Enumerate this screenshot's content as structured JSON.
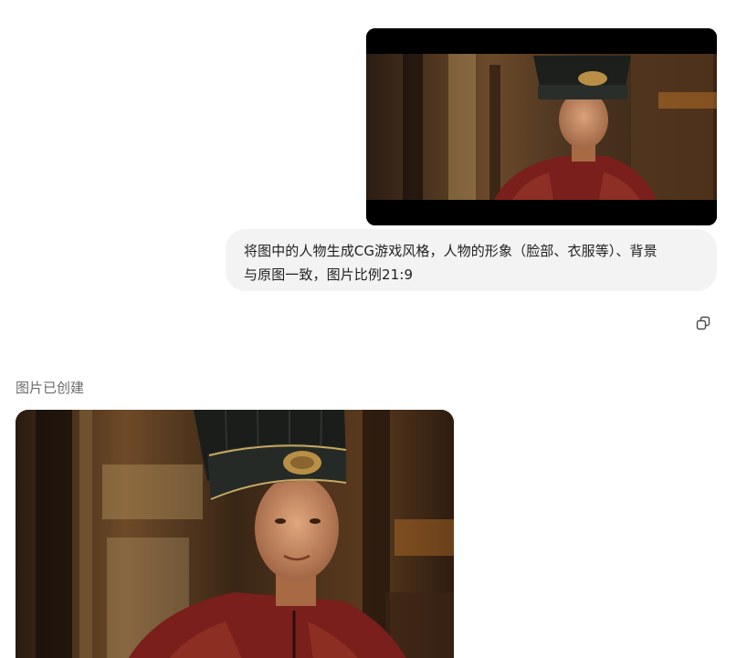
{
  "conversation": {
    "user_message": {
      "image": {
        "alt": "Man in black guan hat and red embroidered robe in palace hall",
        "aspect": "letterboxed"
      },
      "text_line1": "将图中的人物生成CG游戏风格，人物的形象（脸部、衣服等）、背景",
      "text_line2": "与原图一致，图片比例21:9",
      "actions": {
        "copy_icon": "copy-icon"
      }
    },
    "assistant_message": {
      "status": "图片已创建",
      "image": {
        "alt": "CG game style render of the man in black guan hat and red robe"
      }
    }
  },
  "colors": {
    "bubble_bg": "#f3f3f3",
    "status_text": "#6b6b6b",
    "robe_red": "#7a1f1c",
    "hat_black": "#1c1f1c",
    "gold": "#b88f45"
  }
}
